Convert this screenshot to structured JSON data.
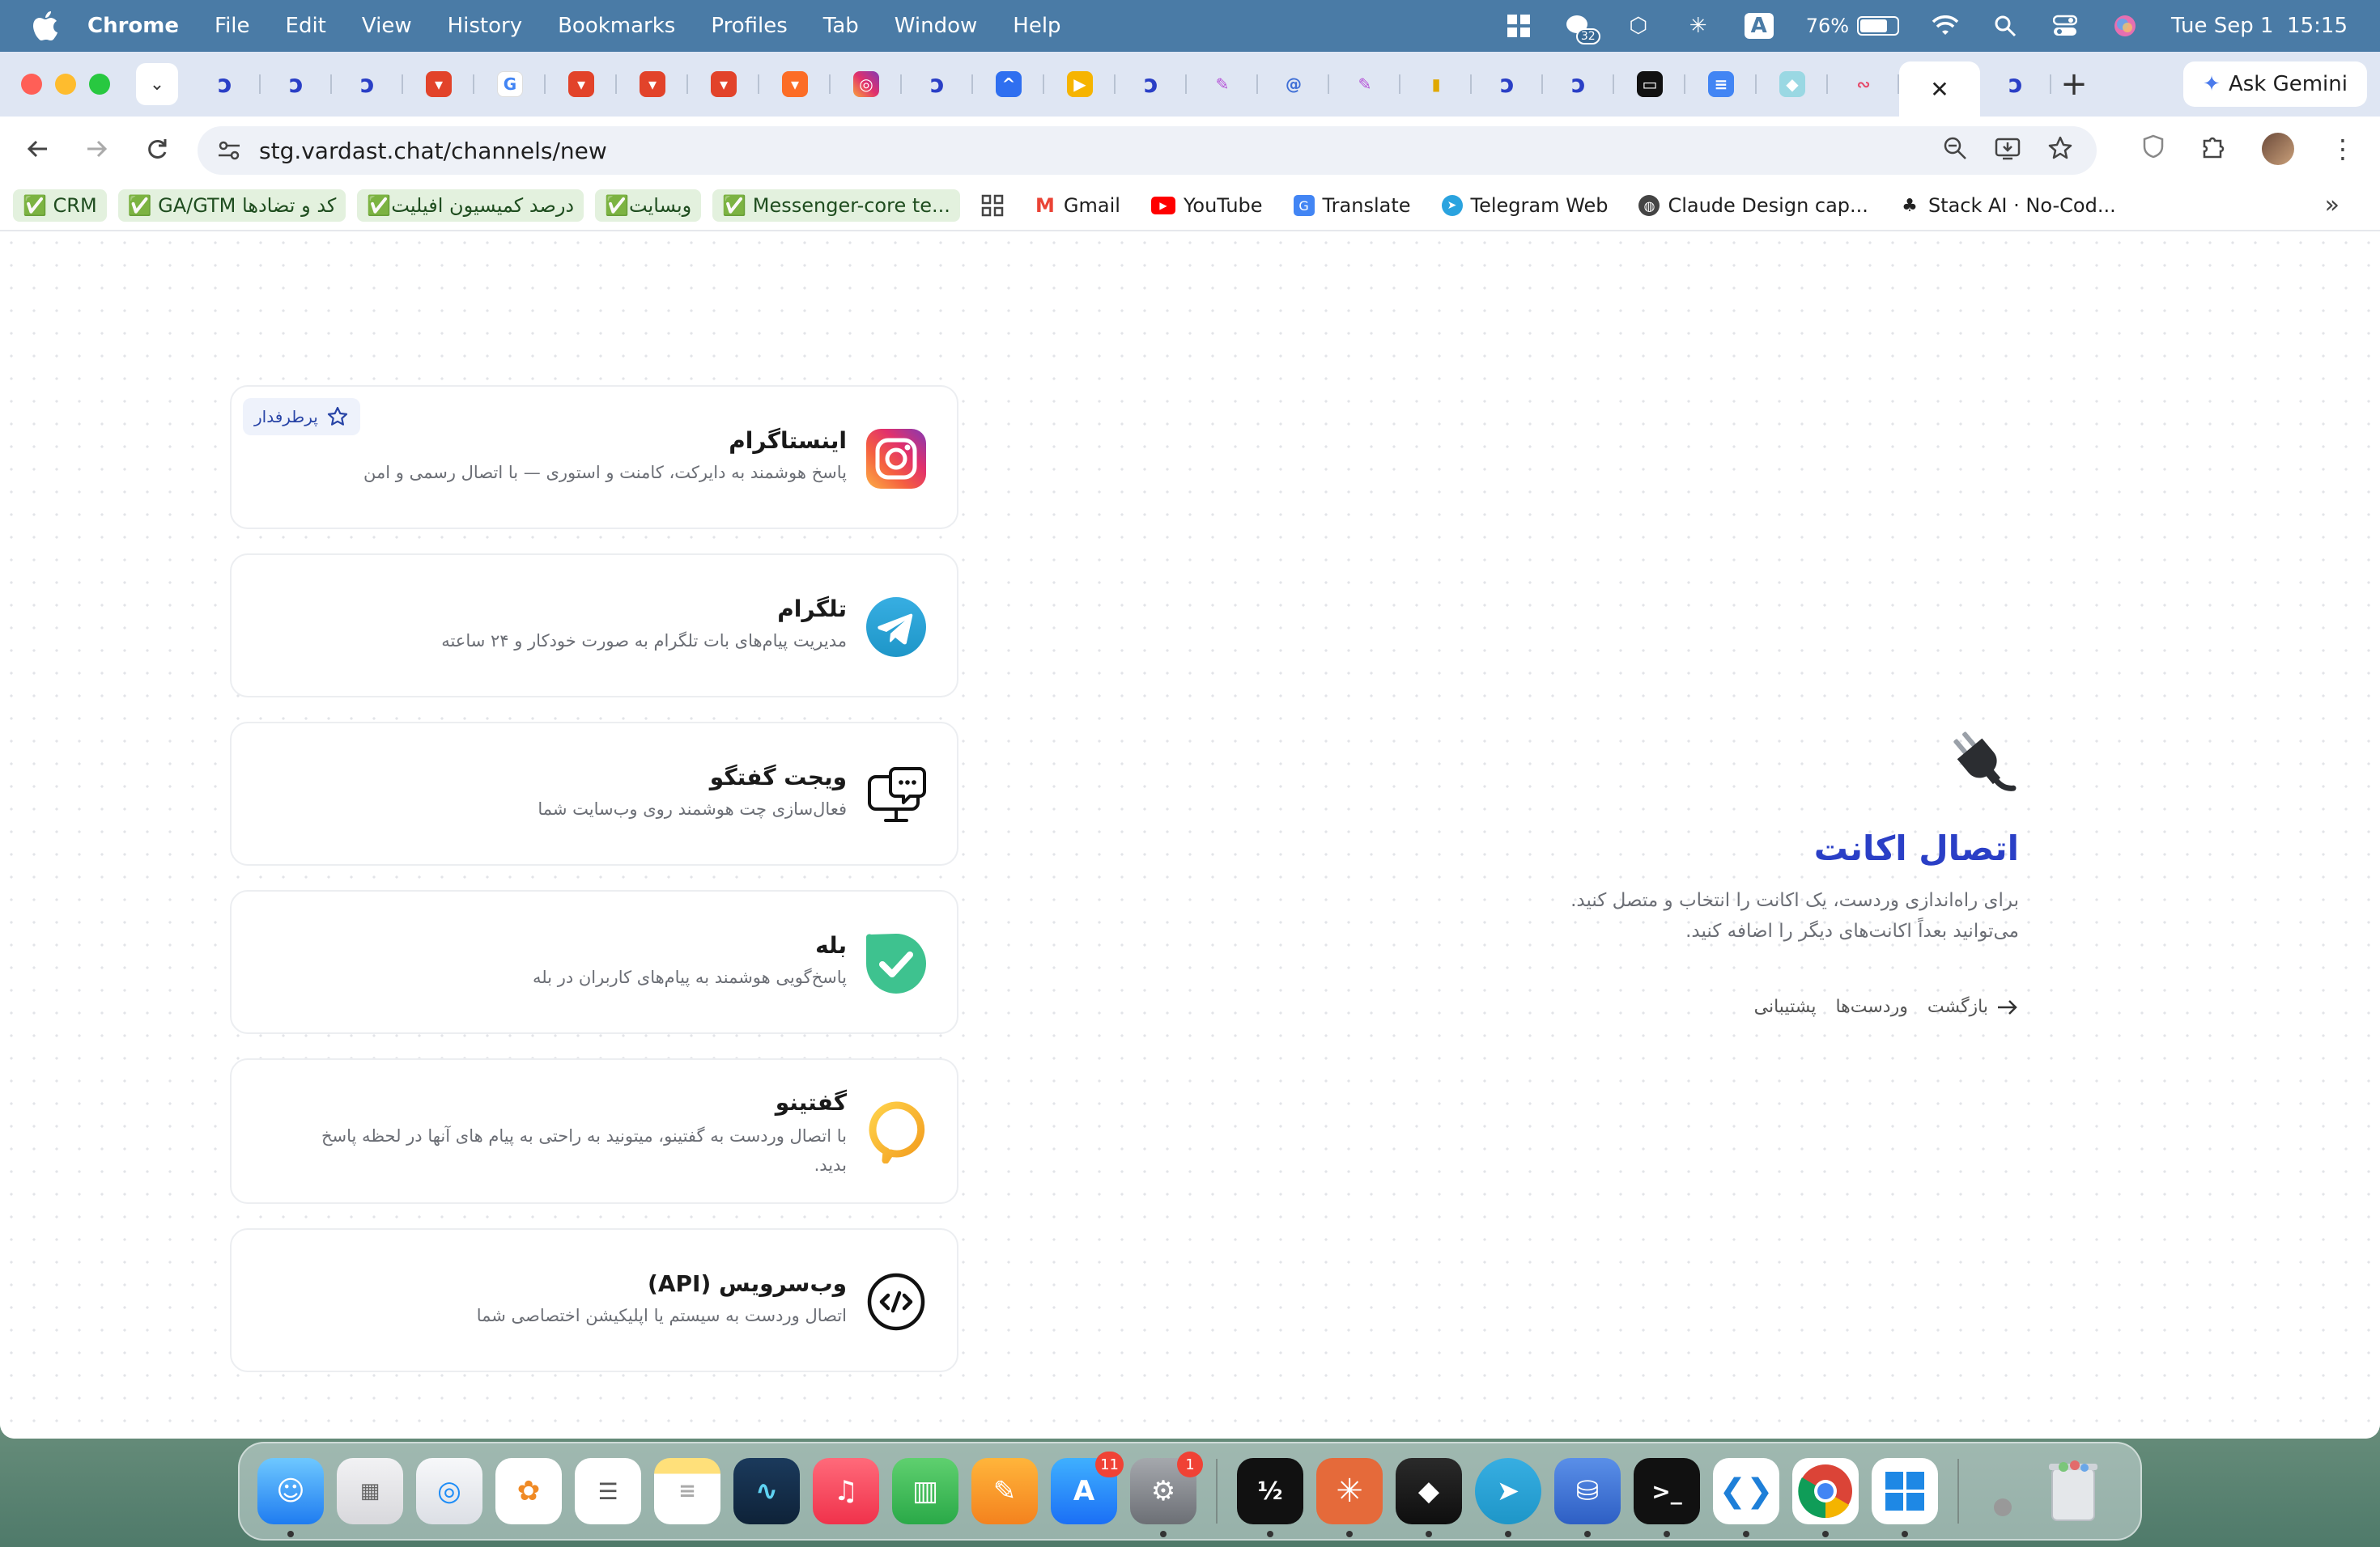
{
  "menubar": {
    "app_name": "Chrome",
    "items": [
      "File",
      "Edit",
      "View",
      "History",
      "Bookmarks",
      "Profiles",
      "Tab",
      "Window",
      "Help"
    ],
    "notification_count": "32",
    "input_source": "A",
    "battery_percent": "76%",
    "battery_level": 0.76,
    "datetime": "Tue Sep 1  15:15"
  },
  "browser": {
    "gemini_label": "Ask Gemini",
    "url": "stg.vardast.chat/channels/new",
    "bookmarks": [
      {
        "label": "✅ CRM",
        "style": "green"
      },
      {
        "label": "✅ GA/GTM کد و تضادها",
        "style": "green"
      },
      {
        "label": "✅درصد کمیسیون افیلیت",
        "style": "green"
      },
      {
        "label": "✅وبسایت",
        "style": "green"
      },
      {
        "label": "✅ Messenger-core te...",
        "style": "green"
      },
      {
        "label": "Gmail",
        "icon": "gmail-icon"
      },
      {
        "label": "YouTube",
        "icon": "youtube-icon"
      },
      {
        "label": "Translate",
        "icon": "translate-icon"
      },
      {
        "label": "Telegram Web",
        "icon": "telegram-icon"
      },
      {
        "label": "Claude Design cap...",
        "icon": "globe-icon"
      },
      {
        "label": "Stack AI · No-Cod...",
        "icon": "stackai-icon"
      }
    ]
  },
  "intro": {
    "title": "اتصال اکانت",
    "line1": "برای راه‌اندازی وردست، یک اکانت را انتخاب و متصل کنید.",
    "line2": "می‌توانید بعداً اکانت‌های دیگر را اضافه کنید.",
    "links": {
      "back": "بازگشت",
      "vardasts": "وردست‌ها",
      "support": "پشتیبانی"
    }
  },
  "channels": [
    {
      "id": "instagram",
      "title": "اینستاگرام",
      "desc": "پاسخ هوشمند به دایرکت، کامنت و استوری — با اتصال رسمی و امن",
      "badge": "پرطرفدار"
    },
    {
      "id": "telegram",
      "title": "تلگرام",
      "desc": "مدیریت پیام‌های بات تلگرام به صورت خودکار و ۲۴ ساعته"
    },
    {
      "id": "widget",
      "title": "ویجت گفتگو",
      "desc": "فعال‌سازی چت هوشمند روی وب‌سایت شما"
    },
    {
      "id": "bale",
      "title": "بله",
      "desc": "پاسخ‌گویی هوشمند به پیام‌های کاربران در بله"
    },
    {
      "id": "goftino",
      "title": "گفتینو",
      "desc_line1": "با اتصال وردست به گفتینو، میتونید به راحتی به پیام های آنها در لحظه پاسخ",
      "desc_line2": "بدید."
    },
    {
      "id": "api",
      "title": "وب‌سرویس (API)",
      "desc": "اتصال وردست به سیستم یا اپلیکیشن اختصاصی شما"
    }
  ],
  "dock": {
    "appstore_badge": "11",
    "settings_badge": "1"
  },
  "colors": {
    "accent": "#2a3fc6",
    "menubar": "#4a7ba6",
    "tabstrip": "#dfe6f3"
  }
}
